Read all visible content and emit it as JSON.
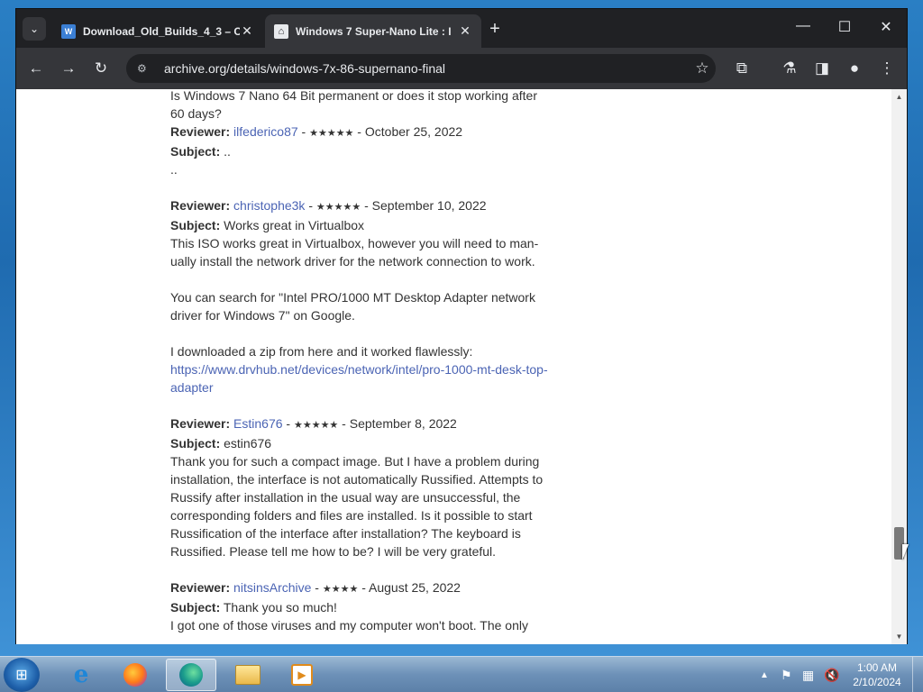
{
  "browser": {
    "tabs": [
      {
        "label": "Download_Old_Builds_4_3 – O",
        "favicon": "web-app-icon",
        "active": false
      },
      {
        "label": "Windows 7 Super-Nano Lite : I",
        "favicon": "archive-institution-icon",
        "active": true
      }
    ],
    "url": "archive.org/details/windows-7x-86-supernano-final"
  },
  "page": {
    "intro_text": "Is Windows 7 Nano 64 Bit permanent or does it stop working after 60 days?",
    "reviewer_label": "Reviewer:",
    "subject_label": "Subject:",
    "reviews": [
      {
        "reviewer": "ilfederico87",
        "stars": "★★★★★",
        "date": "October 25, 2022",
        "subject": "..",
        "body": [
          ".."
        ]
      },
      {
        "reviewer": "christophe3k",
        "stars": "★★★★★",
        "date": "September 10, 2022",
        "subject": "Works great in Virtualbox",
        "body": [
          "This ISO works great in Virtualbox, however you will need to man-ually install the network driver for the network connection to work.",
          "You can search for \"Intel PRO/1000 MT Desktop Adapter network driver for Windows 7\" on Google.",
          "I downloaded a zip from here and it worked flawlessly:"
        ],
        "link": "https://www.drvhub.net/devices/network/intel/pro-1000-mt-desk-top-adapter"
      },
      {
        "reviewer": "Estin676",
        "stars": "★★★★★",
        "date": "September 8, 2022",
        "subject": "estin676",
        "body": [
          "Thank you for such a compact image. But I have a problem during installation, the interface is not automatically Russified. Attempts to Russify after installation in the usual way are unsuccessful, the corresponding folders and files are installed. Is it possible to start Russification of the interface after installation? The keyboard is Russified. Please tell me how to be? I will be very grateful."
        ]
      },
      {
        "reviewer": "nitsinsArchive",
        "stars": "★★★★",
        "date": "August 25, 2022",
        "subject": "Thank you so much!",
        "body": [
          "I got one of those viruses and my computer won't boot. The only"
        ]
      }
    ]
  },
  "taskbar": {
    "apps": [
      "internet-explorer",
      "firefox",
      "edge",
      "file-explorer",
      "media-player"
    ],
    "clock_time": "1:00 AM",
    "clock_date": "2/10/2024"
  }
}
